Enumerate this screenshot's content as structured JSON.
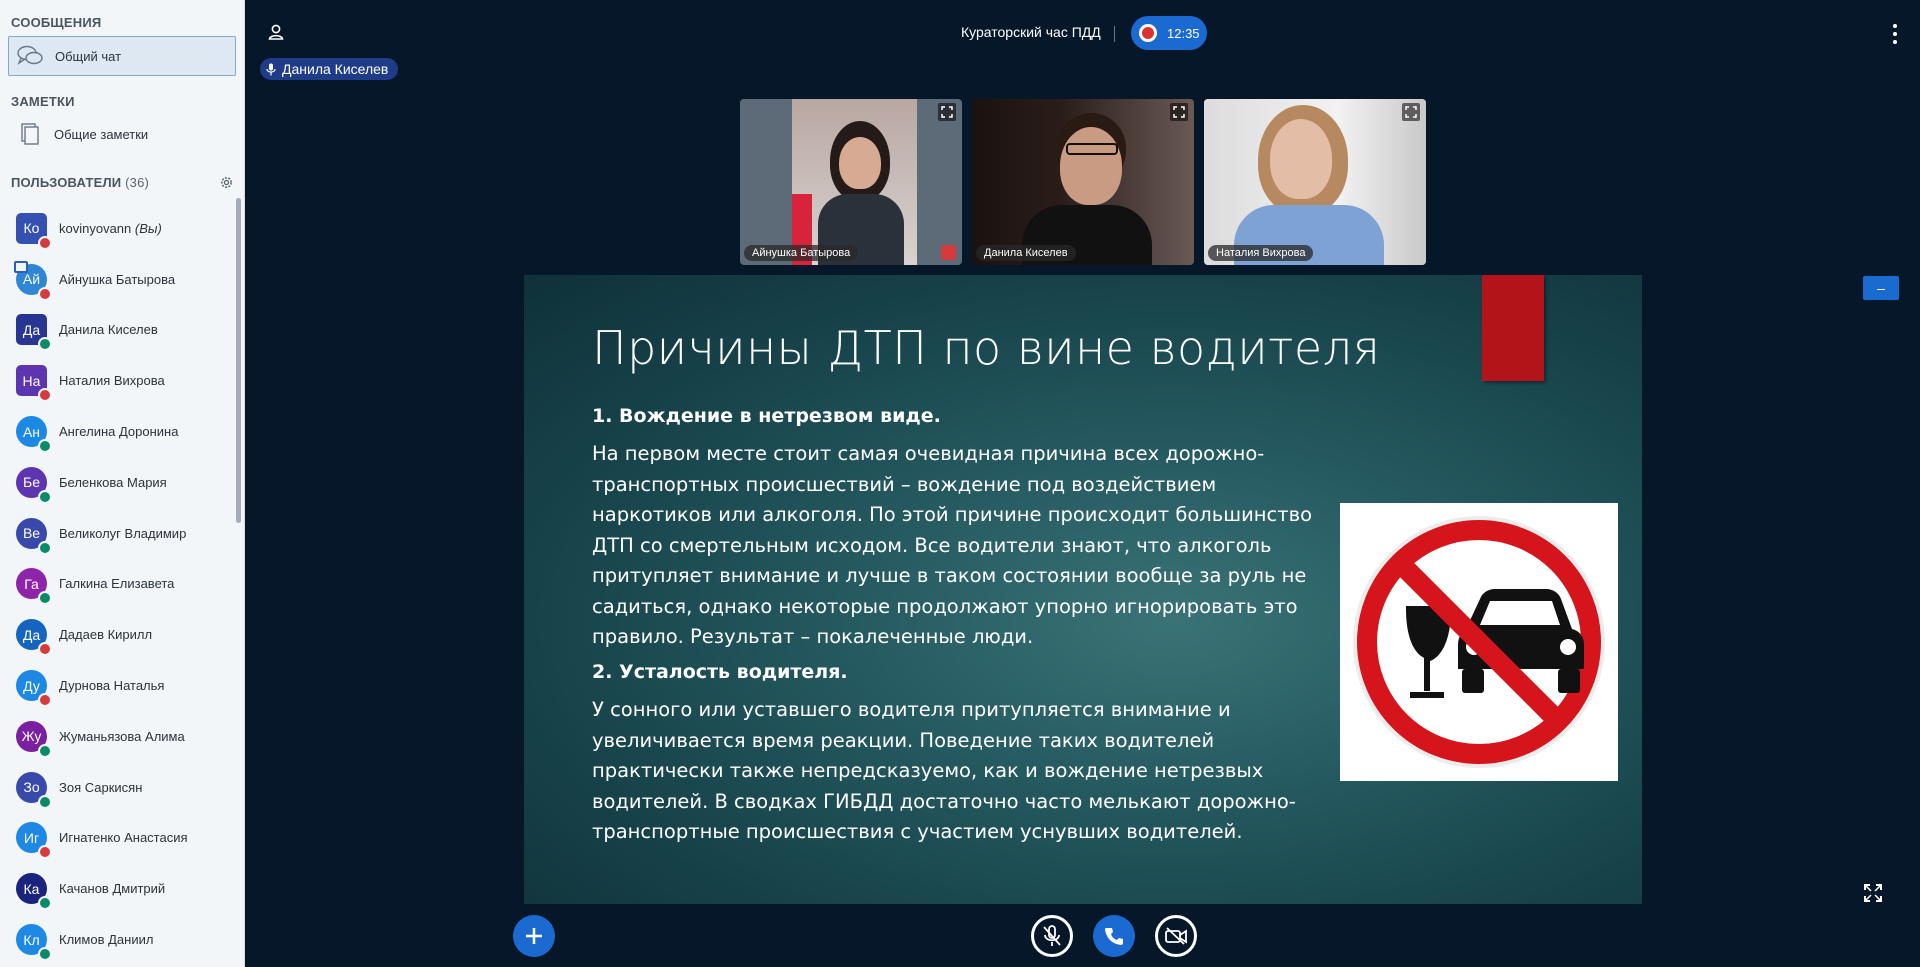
{
  "sidebar": {
    "messages_title": "СООБЩЕНИЯ",
    "public_chat": "Общий чат",
    "notes_title": "ЗАМЕТКИ",
    "shared_notes": "Общие заметки",
    "users_title": "ПОЛЬЗОВАТЕЛИ",
    "users_count": "(36)",
    "users": [
      {
        "initials": "Ко",
        "name": "kovinyovann",
        "suffix": "(Вы)",
        "color": "#3451b2",
        "shape": "square",
        "status": "muted"
      },
      {
        "initials": "Ай",
        "name": "Айнушка Батырова",
        "color": "#2e86d4",
        "shape": "round",
        "status": "muted",
        "presenter": true
      },
      {
        "initials": "Да",
        "name": "Данила Киселев",
        "color": "#283593",
        "shape": "square",
        "status": "listen"
      },
      {
        "initials": "На",
        "name": "Наталия Вихрова",
        "color": "#5e35b1",
        "shape": "square",
        "status": "muted"
      },
      {
        "initials": "Ан",
        "name": "Ангелина Доронина",
        "color": "#1e88e5",
        "shape": "round",
        "status": "listen"
      },
      {
        "initials": "Бе",
        "name": "Беленкова Мария",
        "color": "#5e35b1",
        "shape": "round",
        "status": "listen"
      },
      {
        "initials": "Ве",
        "name": "Великолуг Владимир",
        "color": "#3949ab",
        "shape": "round",
        "status": "listen"
      },
      {
        "initials": "Га",
        "name": "Галкина Елизавета",
        "color": "#8e24aa",
        "shape": "round",
        "status": "listen"
      },
      {
        "initials": "Да",
        "name": "Дадаев Кирилл",
        "color": "#1565c0",
        "shape": "round",
        "status": "muted"
      },
      {
        "initials": "Ду",
        "name": "Дурнова Наталья",
        "color": "#1e88e5",
        "shape": "round",
        "status": "muted"
      },
      {
        "initials": "Жу",
        "name": "Жуманьязова Алима",
        "color": "#7b1fa2",
        "shape": "round",
        "status": "listen"
      },
      {
        "initials": "Зо",
        "name": "Зоя Саркисян",
        "color": "#3949ab",
        "shape": "round",
        "status": "listen"
      },
      {
        "initials": "Иг",
        "name": "Игнатенко Анастасия",
        "color": "#1e88e5",
        "shape": "round",
        "status": "muted"
      },
      {
        "initials": "Ка",
        "name": "Качанов Дмитрий",
        "color": "#1a237e",
        "shape": "round",
        "status": "listen"
      },
      {
        "initials": "Кл",
        "name": "Климов Даниил",
        "color": "#1e88e5",
        "shape": "round",
        "status": "listen"
      }
    ]
  },
  "header": {
    "meeting_title": "Кураторский час ПДД",
    "rec_time": "12:35",
    "talking_user": "Данила Киселев"
  },
  "videos": [
    {
      "name": "Айнушка Батырова",
      "muted": true
    },
    {
      "name": "Данила Киселев",
      "muted": false
    },
    {
      "name": "Наталия Вихрова",
      "muted": false
    }
  ],
  "slide": {
    "title": "Причины ДТП по вине водителя",
    "h1": "1. Вождение в нетрезвом виде.",
    "p1": "На первом месте стоит самая очевидная причина всех дорожно-транспортных происшествий – вождение под воздействием наркотиков или алкоголя. По этой причине происходит большинство ДТП со смертельным исходом. Все водители знают, что алкоголь притупляет внимание и лучше в таком состоянии вообще за руль не садиться, однако некоторые продолжают упорно игнорировать это правило. Результат – покалеченные люди.",
    "h2": "2. Усталость водителя.",
    "p2": "У сонного или уставшего водителя притупляется внимание и увеличивается время реакции. Поведение таких водителей практически также непредсказуемо, как и вождение нетрезвых водителей. В сводках ГИБДД достаточно часто мелькают дорожно-транспортные происшествия с участием уснувших водителей."
  },
  "colors": {
    "accent": "#1b6ad1",
    "muted_status": "#d63b3b",
    "listen_status": "#0b8a6a",
    "background": "#06172a"
  }
}
